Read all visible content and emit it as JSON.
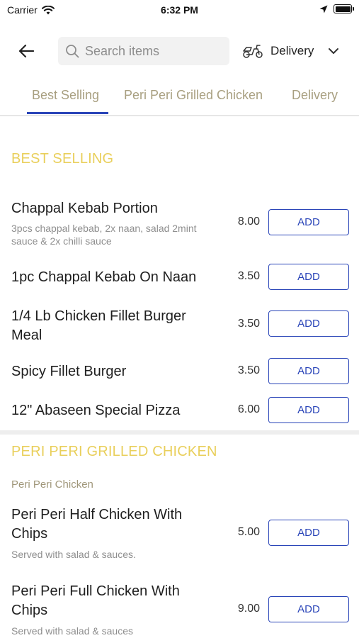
{
  "status_bar": {
    "carrier": "Carrier",
    "time": "6:32 PM"
  },
  "header": {
    "search_placeholder": "Search items",
    "delivery_label": "Delivery"
  },
  "tabs": [
    {
      "label": "Best Selling",
      "active": true
    },
    {
      "label": "Peri Peri Grilled Chicken",
      "active": false
    },
    {
      "label": "Delivery",
      "active": false
    }
  ],
  "sections": [
    {
      "title": "BEST SELLING",
      "items": [
        {
          "name": "Chappal Kebab Portion",
          "desc": "3pcs chappal kebab, 2x naan, salad 2mint sauce & 2x chilli sauce",
          "price": "8.00",
          "action": "ADD"
        },
        {
          "name": "1pc Chappal Kebab On Naan",
          "price": "3.50",
          "action": "ADD"
        },
        {
          "name": "1/4 Lb Chicken Fillet Burger Meal",
          "price": "3.50",
          "action": "ADD"
        },
        {
          "name": "Spicy Fillet Burger",
          "price": "3.50",
          "action": "ADD"
        },
        {
          "name": "12\" Abaseen Special Pizza",
          "price": "6.00",
          "action": "ADD"
        }
      ]
    },
    {
      "title": "PERI PERI GRILLED CHICKEN",
      "subcategory": "Peri Peri Chicken",
      "items": [
        {
          "name": "Peri Peri Half Chicken With Chips",
          "desc": "Served with salad & sauces.",
          "price": "5.00",
          "action": "ADD"
        },
        {
          "name": "Peri Peri Full Chicken With Chips",
          "desc": "Served with salad & sauces",
          "price": "9.00",
          "action": "ADD"
        }
      ]
    }
  ],
  "colors": {
    "accent": "#2a45b8",
    "section_title": "#e9cf5b",
    "tab_inactive": "#a89f80"
  },
  "icons": {
    "back": "arrow-left-icon",
    "search": "search-icon",
    "delivery": "scooter-icon",
    "dropdown": "chevron-down-icon"
  }
}
